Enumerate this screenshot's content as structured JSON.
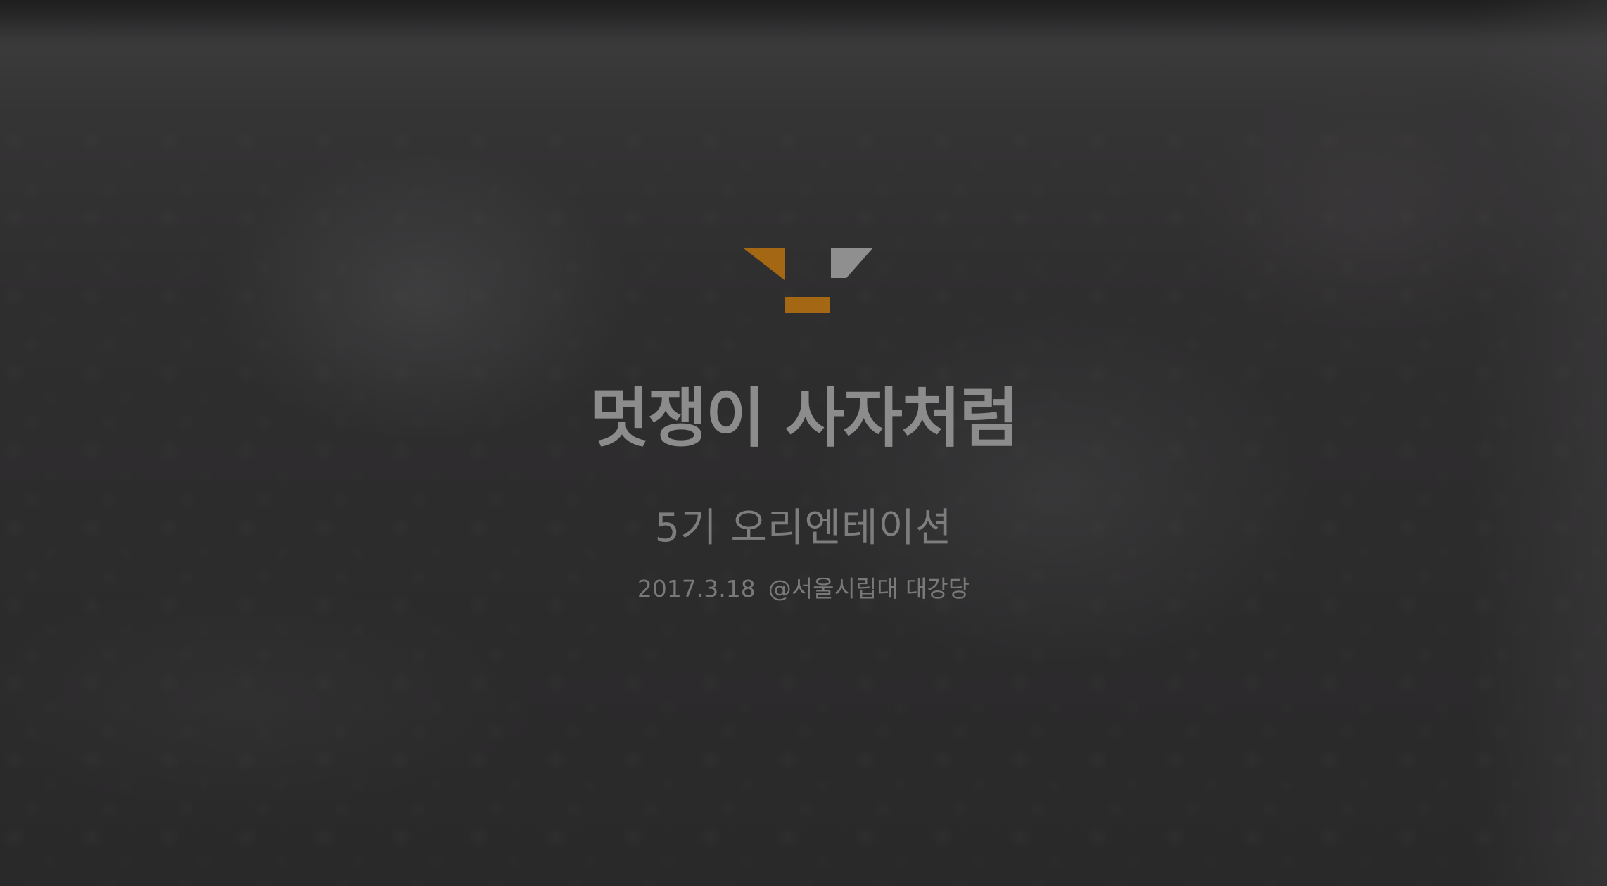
{
  "slide": {
    "title": "멋쟁이 사자처럼",
    "subtitle": "5기 오리엔테이션",
    "date": "2017.3.18",
    "venue": "@서울시립대 대강당"
  },
  "logo": {
    "icon": "likelion-logo-icon",
    "accent_color": "#a46714",
    "secondary_color": "#8f8f8f"
  },
  "colors": {
    "background": "#2e2d2e",
    "title": "#8c8c8c",
    "subtitle": "#7d7d7d",
    "meta": "#797979"
  }
}
